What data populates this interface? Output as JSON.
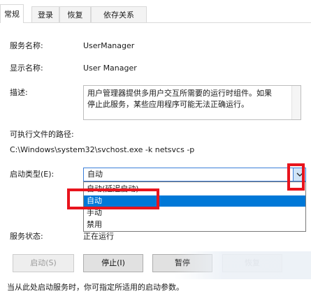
{
  "tabs": [
    {
      "label": "常规",
      "active": true
    },
    {
      "label": "登录",
      "active": false
    },
    {
      "label": "恢复",
      "active": false
    },
    {
      "label": "依存关系",
      "active": false
    }
  ],
  "service": {
    "name_label": "服务名称:",
    "name_value": "UserManager",
    "display_label": "显示名称:",
    "display_value": "User Manager",
    "desc_label": "描述:",
    "desc_line1": "用户管理器提供多用户交互所需要的运行时组件。如果",
    "desc_line2": "停止此服务，某些应用程序可能无法正确运行。",
    "path_label": "可执行文件的路径:",
    "path_value": "C:\\Windows\\system32\\svchost.exe -k netsvcs -p"
  },
  "startup": {
    "label": "启动类型(E):",
    "selected": "自动",
    "options": [
      "自动(延迟启动)",
      "自动",
      "手动",
      "禁用"
    ],
    "highlighted_index": 1
  },
  "status": {
    "label": "服务状态:",
    "value": "正在运行"
  },
  "buttons": {
    "start": "启动(S)",
    "stop": "停止(I)",
    "pause": "暂停",
    "resume": "恢复"
  },
  "footer_text": "当从此处启动服务时，你可指定所适用的启动参数。",
  "colors": {
    "selection": "#0078d7",
    "annotation_red": "#e8141d",
    "focus_border": "#3c7fd9"
  }
}
